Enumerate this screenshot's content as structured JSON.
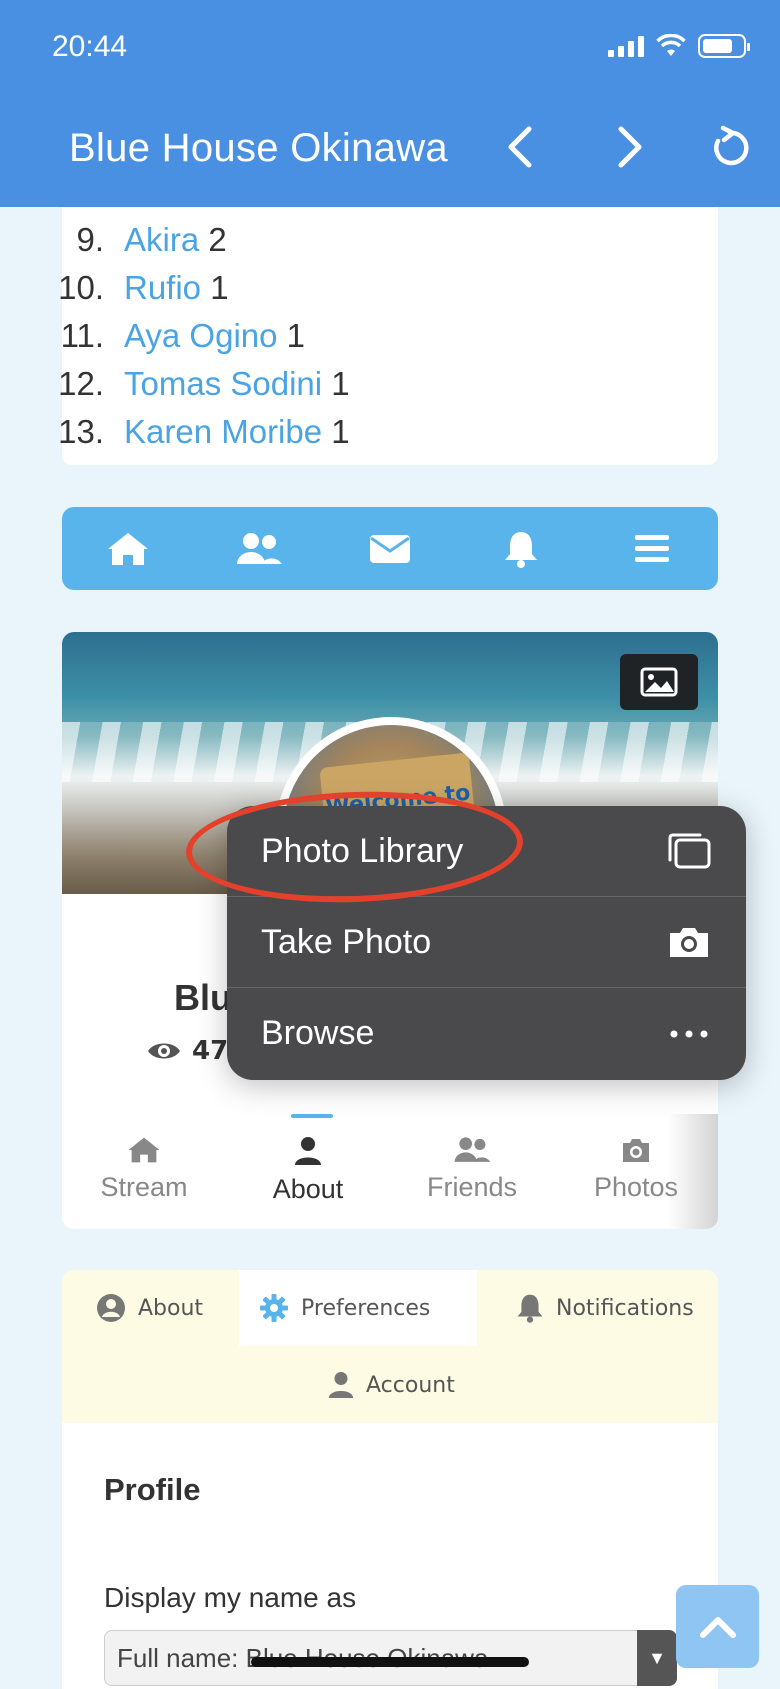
{
  "status_bar": {
    "time": "20:44"
  },
  "header": {
    "title": "Blue House Okinawa"
  },
  "ranking_list": [
    {
      "rank": "9.",
      "name": "Akira",
      "count": "2"
    },
    {
      "rank": "10.",
      "name": "Rufio",
      "count": "1"
    },
    {
      "rank": "11.",
      "name": "Aya Ogino",
      "count": "1"
    },
    {
      "rank": "12.",
      "name": "Tomas Sodini",
      "count": "1"
    },
    {
      "rank": "13.",
      "name": "Karen Moribe",
      "count": "1"
    }
  ],
  "nav_icons": [
    "home-icon",
    "users-icon",
    "envelope-icon",
    "bell-icon",
    "menu-icon"
  ],
  "profile": {
    "name_partial": "Blu",
    "views_partial": "47",
    "avatar_sign_text": "Welcome to",
    "tabs": [
      {
        "label": "Stream",
        "icon": "home-icon"
      },
      {
        "label": "About",
        "icon": "user-icon",
        "active": true
      },
      {
        "label": "Friends",
        "icon": "users-icon"
      },
      {
        "label": "Photos",
        "icon": "camera-icon"
      }
    ]
  },
  "settings": {
    "tabs": [
      {
        "label": "About",
        "icon": "user-circle-icon"
      },
      {
        "label": "Preferences",
        "icon": "gear-icon",
        "active": true
      },
      {
        "label": "Notifications",
        "icon": "bell-icon"
      },
      {
        "label": "Account",
        "icon": "user-icon"
      }
    ],
    "section_title": "Profile",
    "display_name_label": "Display my name as",
    "display_name_value": "Full name: Blue House Okinawa"
  },
  "context_menu": {
    "items": [
      {
        "label": "Photo Library",
        "icon": "photo-library-icon"
      },
      {
        "label": "Take Photo",
        "icon": "camera-icon"
      },
      {
        "label": "Browse",
        "icon": "more-icon"
      }
    ]
  },
  "colors": {
    "header": "#4a90e2",
    "accent": "#5ab4ec",
    "link": "#4aa3e2",
    "highlight": "#e4412c"
  }
}
